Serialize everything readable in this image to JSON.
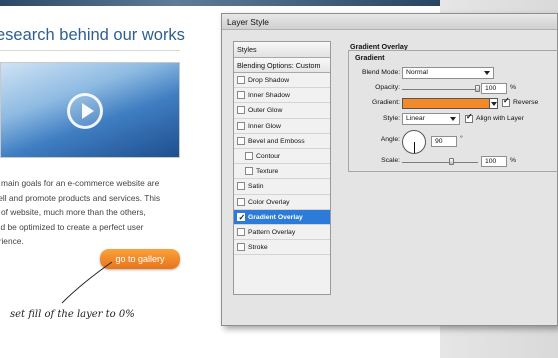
{
  "webpage": {
    "heading": "esearch behind our works",
    "body_lines": [
      "e main goals for an e-commerce website are",
      "sell and promote products and services. This",
      "d of website, much more than the others,",
      "uld be optimized to create a perfect user",
      "erience."
    ],
    "gallery_button": "go to gallery",
    "annotation": "set fill of the layer to 0%"
  },
  "dialog": {
    "title": "Layer Style",
    "styles_header": "Styles",
    "blending_options": "Blending Options: Custom",
    "style_items": [
      {
        "label": "Drop Shadow",
        "checked": false,
        "indent": false,
        "active": false
      },
      {
        "label": "Inner Shadow",
        "checked": false,
        "indent": false,
        "active": false
      },
      {
        "label": "Outer Glow",
        "checked": false,
        "indent": false,
        "active": false
      },
      {
        "label": "Inner Glow",
        "checked": false,
        "indent": false,
        "active": false
      },
      {
        "label": "Bevel and Emboss",
        "checked": false,
        "indent": false,
        "active": false
      },
      {
        "label": "Contour",
        "checked": false,
        "indent": true,
        "active": false
      },
      {
        "label": "Texture",
        "checked": false,
        "indent": true,
        "active": false
      },
      {
        "label": "Satin",
        "checked": false,
        "indent": false,
        "active": false
      },
      {
        "label": "Color Overlay",
        "checked": false,
        "indent": false,
        "active": false
      },
      {
        "label": "Gradient Overlay",
        "checked": true,
        "indent": false,
        "active": true
      },
      {
        "label": "Pattern Overlay",
        "checked": false,
        "indent": false,
        "active": false
      },
      {
        "label": "Stroke",
        "checked": false,
        "indent": false,
        "active": false
      }
    ],
    "panel": {
      "section_title": "Gradient Overlay",
      "group_title": "Gradient",
      "blend_mode_label": "Blend Mode:",
      "blend_mode_value": "Normal",
      "opacity_label": "Opacity:",
      "opacity_value": "100",
      "opacity_unit": "%",
      "opacity_fraction": 1.0,
      "gradient_label": "Gradient:",
      "gradient_color": "#f28a2a",
      "reverse_label": "Reverse",
      "reverse_checked": true,
      "style_label": "Style:",
      "style_value": "Linear",
      "align_label": "Align with Layer",
      "align_checked": true,
      "angle_label": "Angle:",
      "angle_value": "90",
      "angle_unit": "°",
      "scale_label": "Scale:",
      "scale_value": "100",
      "scale_unit": "%",
      "scale_fraction": 0.66
    }
  },
  "colors": {
    "accent_blue": "#2d7bd8",
    "button_orange": "#f28a2a",
    "heading_blue": "#2f5f8f"
  }
}
